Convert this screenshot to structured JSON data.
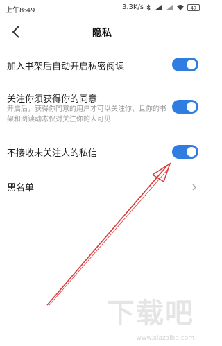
{
  "status_bar": {
    "time": "上午8:49",
    "network_speed": "3.3K/s",
    "battery": "47"
  },
  "header": {
    "title": "隐私"
  },
  "settings": {
    "auto_private_label": "加入书架后自动开启私密阅读",
    "auto_private_on": true,
    "follow_consent_label": "关注你须获得你的同意",
    "follow_consent_desc": "开启后，获得你同意的用户才可以关注你，且你的书架和阅读动态仅对关注你的人可见",
    "follow_consent_on": true,
    "reject_dm_label": "不接收未关注人的私信",
    "reject_dm_on": true,
    "blacklist_label": "黑名单"
  },
  "colors": {
    "accent": "#2f7de1",
    "annotation_arrow": "#d83a3a"
  },
  "watermark": {
    "logo_text": "下载吧",
    "url": "www.xiazaiba.com"
  }
}
